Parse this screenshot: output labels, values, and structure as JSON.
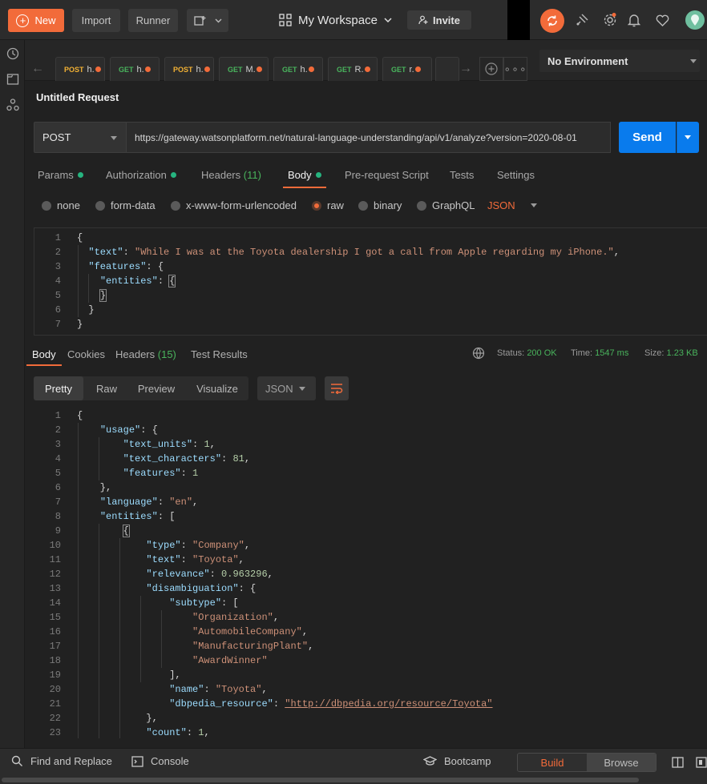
{
  "topbar": {
    "new_label": "New",
    "import_label": "Import",
    "runner_label": "Runner",
    "workspace_label": "My Workspace",
    "invite_label": "Invite"
  },
  "tabs": [
    {
      "method": "POST",
      "label": "h."
    },
    {
      "method": "GET",
      "label": "h."
    },
    {
      "method": "POST",
      "label": "h."
    },
    {
      "method": "GET",
      "label": "M."
    },
    {
      "method": "GET",
      "label": "h."
    },
    {
      "method": "GET",
      "label": "R."
    },
    {
      "method": "GET",
      "label": "r."
    }
  ],
  "environment": {
    "selected": "No Environment"
  },
  "request": {
    "title": "Untitled Request",
    "method": "POST",
    "url": "https://gateway.watsonplatform.net/natural-language-understanding/api/v1/analyze?version=2020-08-01",
    "send_label": "Send"
  },
  "request_tabs": {
    "params": "Params",
    "authorization": "Authorization",
    "headers": "Headers",
    "headers_count": "(11)",
    "body": "Body",
    "prerequest": "Pre-request Script",
    "tests": "Tests",
    "settings": "Settings"
  },
  "body_modes": {
    "none": "none",
    "form_data": "form-data",
    "urlencoded": "x-www-form-urlencoded",
    "raw": "raw",
    "binary": "binary",
    "graphql": "GraphQL",
    "format": "JSON",
    "selected": "raw"
  },
  "request_body_lines": [
    "1",
    "2",
    "3",
    "4",
    "5",
    "6",
    "7"
  ],
  "response_tabs": {
    "body": "Body",
    "cookies": "Cookies",
    "headers": "Headers",
    "headers_count": "(15)",
    "test_results": "Test Results"
  },
  "response_meta": {
    "status_label": "Status:",
    "status_value": "200 OK",
    "time_label": "Time:",
    "time_value": "1547 ms",
    "size_label": "Size:",
    "size_value": "1.23 KB"
  },
  "response_views": {
    "pretty": "Pretty",
    "raw": "Raw",
    "preview": "Preview",
    "visualize": "Visualize",
    "format": "JSON"
  },
  "response_lines": [
    "1",
    "2",
    "3",
    "4",
    "5",
    "6",
    "7",
    "8",
    "9",
    "10",
    "11",
    "12",
    "13",
    "14",
    "15",
    "16",
    "17",
    "18",
    "19",
    "20",
    "21",
    "22",
    "23"
  ],
  "footer": {
    "find_replace": "Find and Replace",
    "console": "Console",
    "bootcamp": "Bootcamp",
    "build": "Build",
    "browse": "Browse"
  },
  "colors": {
    "accent": "#f26b3a",
    "send": "#097bed",
    "status_green": "#49b35c"
  }
}
